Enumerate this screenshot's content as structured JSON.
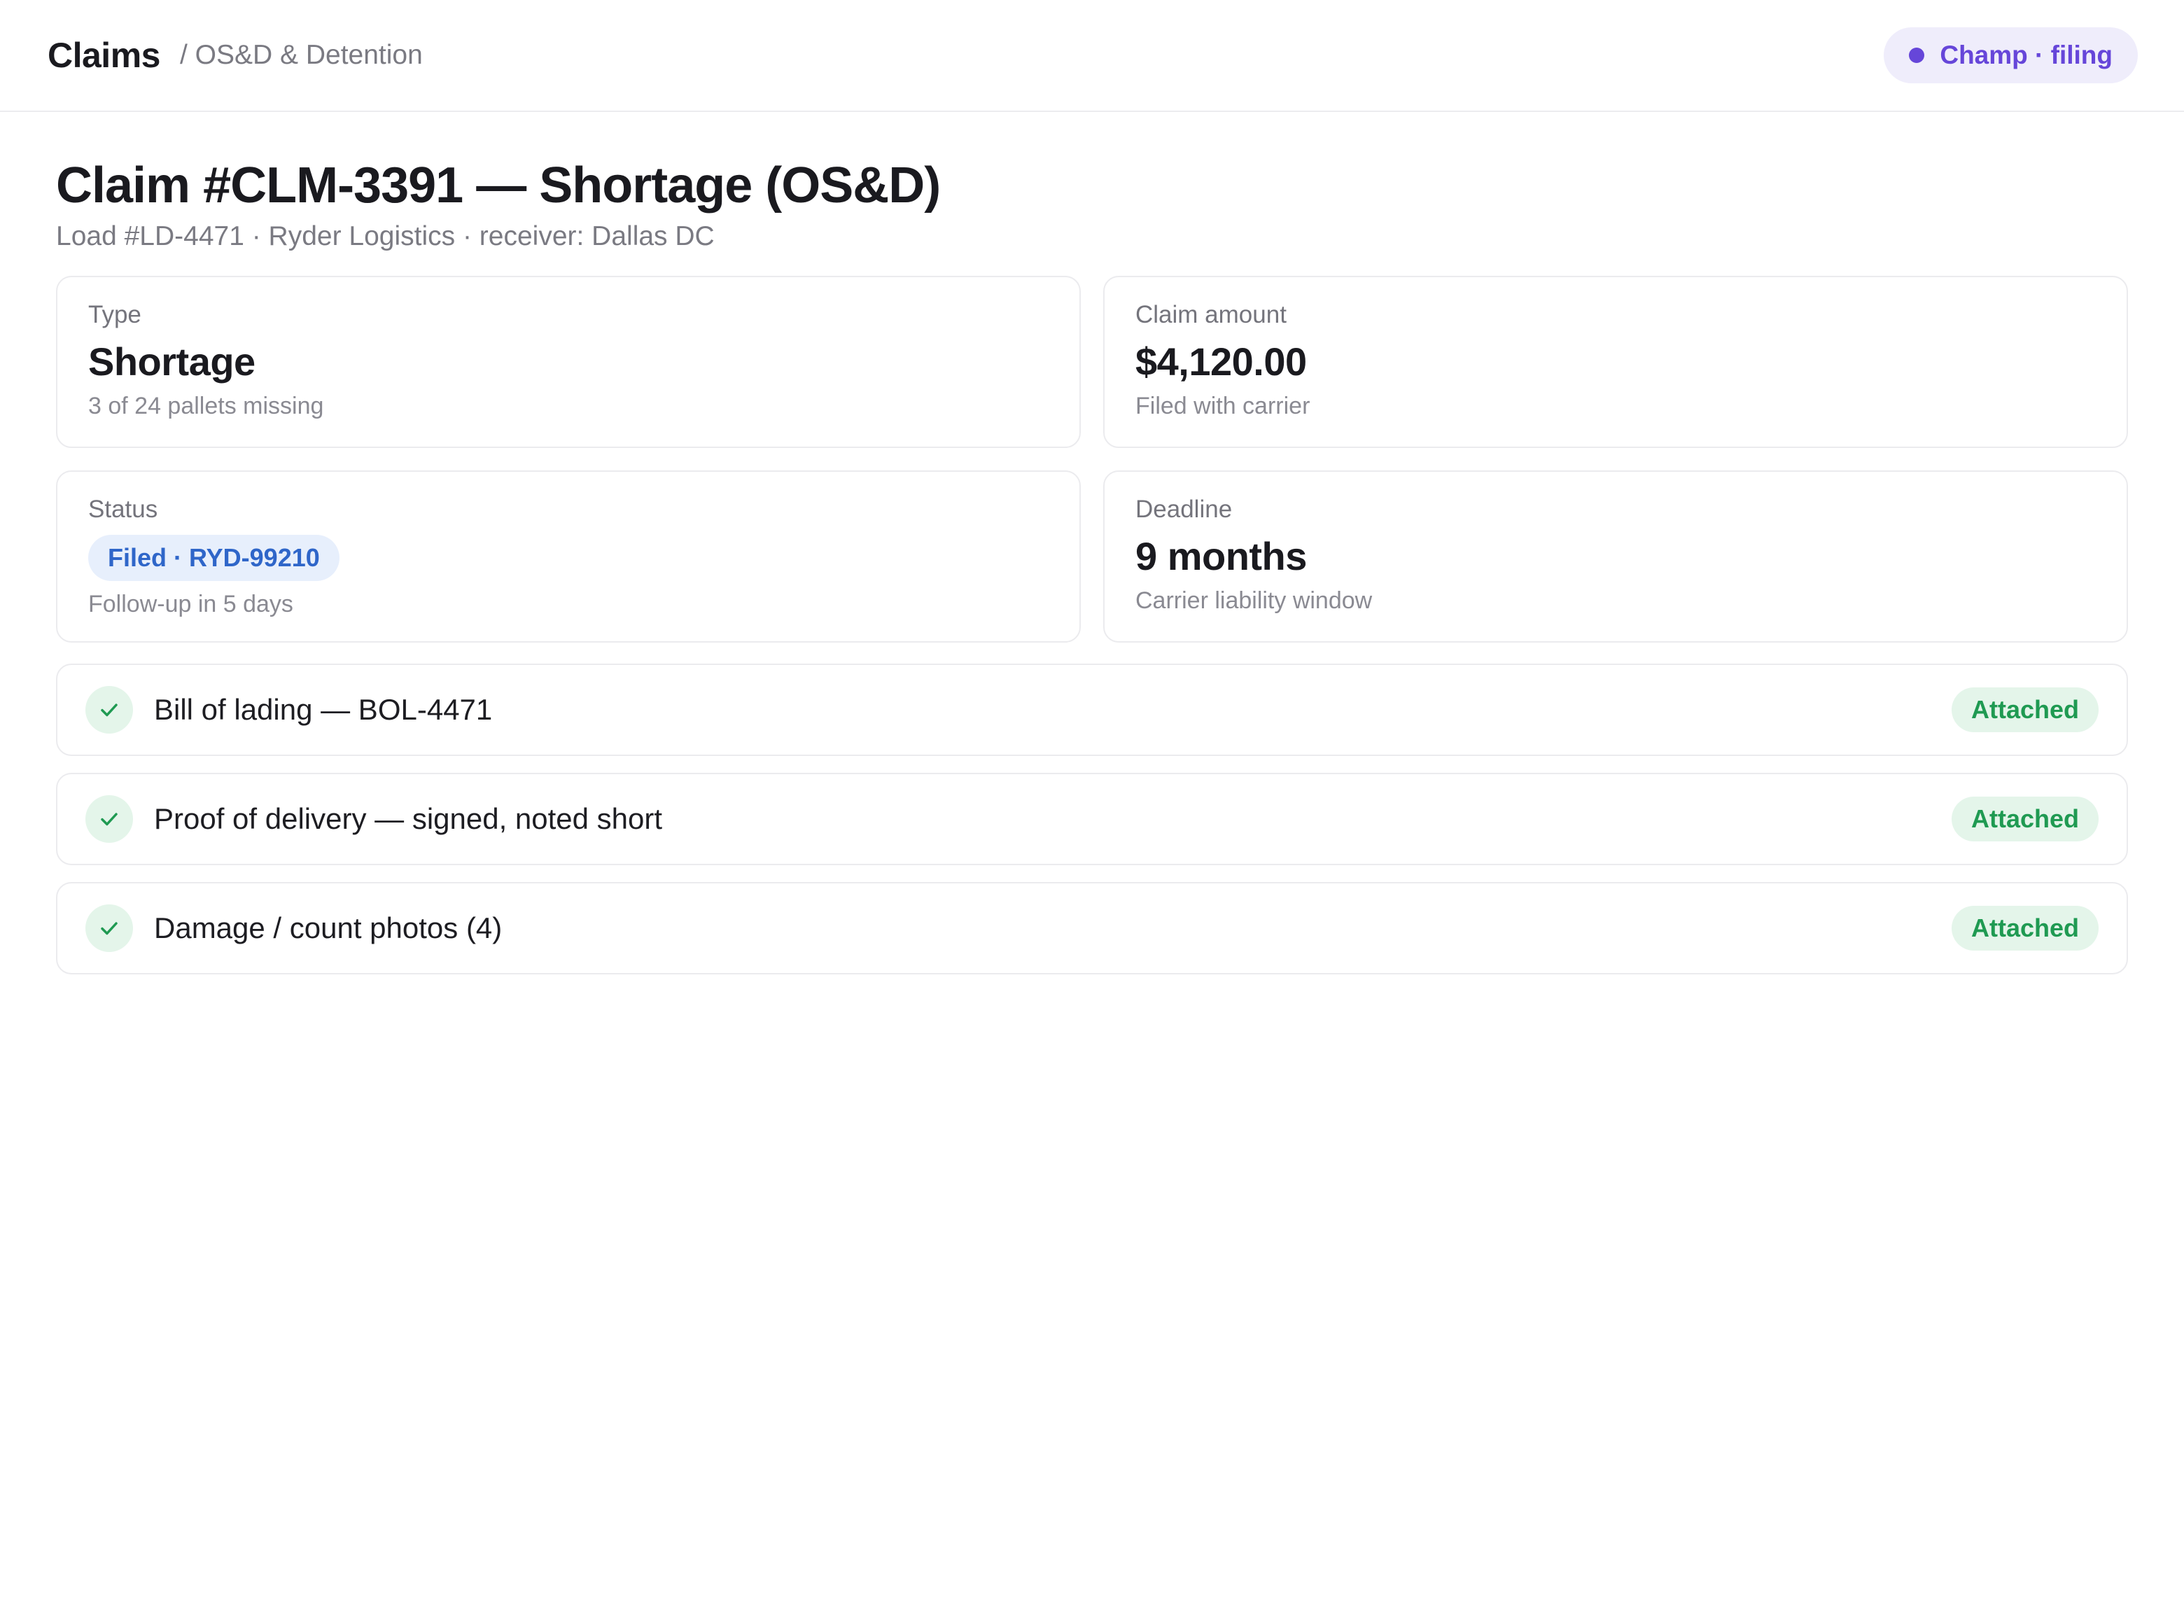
{
  "header": {
    "app_title": "Claims",
    "breadcrumb": "/ OS&D & Detention",
    "agent_status": "Champ · filing"
  },
  "claim": {
    "title": "Claim #CLM-3391 — Shortage (OS&D)",
    "subtitle": "Load #LD-4471 · Ryder Logistics · receiver: Dallas DC"
  },
  "cards": {
    "type": {
      "label": "Type",
      "value": "Shortage",
      "note": "3 of 24 pallets missing"
    },
    "amount": {
      "label": "Claim amount",
      "value": "$4,120.00",
      "note": "Filed with carrier"
    },
    "status": {
      "label": "Status",
      "badge": "Filed · RYD-99210",
      "note": "Follow-up in 5 days"
    },
    "deadline": {
      "label": "Deadline",
      "value": "9 months",
      "note": "Carrier liability window"
    }
  },
  "documents": [
    {
      "label": "Bill of lading — BOL-4471",
      "status": "Attached"
    },
    {
      "label": "Proof of delivery — signed, noted short",
      "status": "Attached"
    },
    {
      "label": "Damage / count photos (4)",
      "status": "Attached"
    }
  ],
  "colors": {
    "accent": "#6646d9",
    "status_blue": "#2f66c9",
    "success_green": "#1f9a52"
  },
  "icons": {
    "agent": "status-dot-icon",
    "document": "check-icon"
  }
}
